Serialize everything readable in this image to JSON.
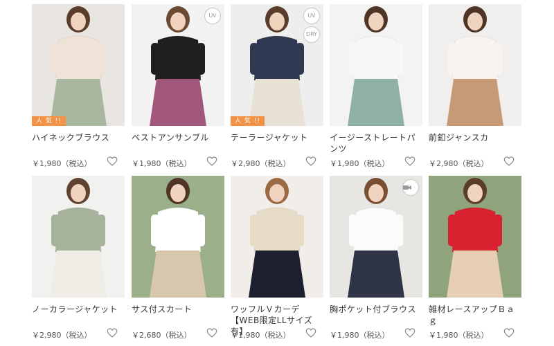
{
  "products": [
    {
      "name": "ハイネックブラウス",
      "price": "￥1,980（税込）",
      "badges": [],
      "popular": "人 気 !!",
      "colors": {
        "bg": "#e9e6e2",
        "top": "#efe2d7",
        "bottom": "#a9b6a0",
        "hair": "#5a3d2b"
      }
    },
    {
      "name": "ベストアンサンブル",
      "price": "￥1,980（税込）",
      "badges": [
        "UV"
      ],
      "popular": "",
      "colors": {
        "bg": "#f2f2f2",
        "top": "#1f1f1f",
        "bottom": "#a0577a",
        "hair": "#6b4a33"
      }
    },
    {
      "name": "テーラージャケット",
      "price": "￥2,980（税込）",
      "badges": [
        "UV",
        "DRY"
      ],
      "popular": "人 気 !!",
      "colors": {
        "bg": "#eeeeee",
        "top": "#2f3a52",
        "bottom": "#e7e1d6",
        "hair": "#5a3d2b"
      }
    },
    {
      "name": "イージーストレートパンツ",
      "price": "￥1,980（税込）",
      "badges": [],
      "popular": "",
      "colors": {
        "bg": "#f3f3f3",
        "top": "#f7f7f7",
        "bottom": "#8fb0a4",
        "hair": "#4e3526"
      }
    },
    {
      "name": "前釦ジャンスカ",
      "price": "￥2,980（税込）",
      "badges": [],
      "popular": "",
      "colors": {
        "bg": "#f0efed",
        "top": "#f7f4ef",
        "bottom": "#c79a76",
        "hair": "#4e3526"
      }
    },
    {
      "name": "ノーカラージャケット",
      "price": "￥2,980（税込）",
      "badges": [],
      "popular": "",
      "colors": {
        "bg": "#f1f1ef",
        "top": "#a6b39a",
        "bottom": "#efece6",
        "hair": "#5f4330"
      }
    },
    {
      "name": "サス付スカート",
      "price": "￥2,680（税込）",
      "badges": [],
      "popular": "",
      "colors": {
        "bg": "#9bb08a",
        "top": "#ffffff",
        "bottom": "#d8c6ad",
        "hair": "#4e3526"
      }
    },
    {
      "name": "ワッフルＶカーデ【WEB限定LLサイズ有】",
      "price": "￥1,980（税込）",
      "badges": [],
      "popular": "",
      "colors": {
        "bg": "#f1eeea",
        "top": "#e6dcc6",
        "bottom": "#1e2030",
        "hair": "#9a6a45"
      }
    },
    {
      "name": "胸ポケット付ブラウス",
      "price": "￥1,980（税込）",
      "badges": [
        "video"
      ],
      "popular": "",
      "colors": {
        "bg": "#e8e6e2",
        "top": "#fbfbfb",
        "bottom": "#2f3446",
        "hair": "#7a4e33"
      }
    },
    {
      "name": "雑材レースアップＢａｇ",
      "price": "￥1,980（税込）",
      "badges": [],
      "popular": "",
      "colors": {
        "bg": "#8fa37c",
        "top": "#d8202f",
        "bottom": "#e6cfb2",
        "hair": "#5a3d2b"
      }
    }
  ],
  "icons": {
    "favorite": "heart-outline-icon",
    "video": "video-camera-icon"
  },
  "accent": {
    "popular_bg": "#f29245",
    "heart": "#8a8a8a"
  }
}
